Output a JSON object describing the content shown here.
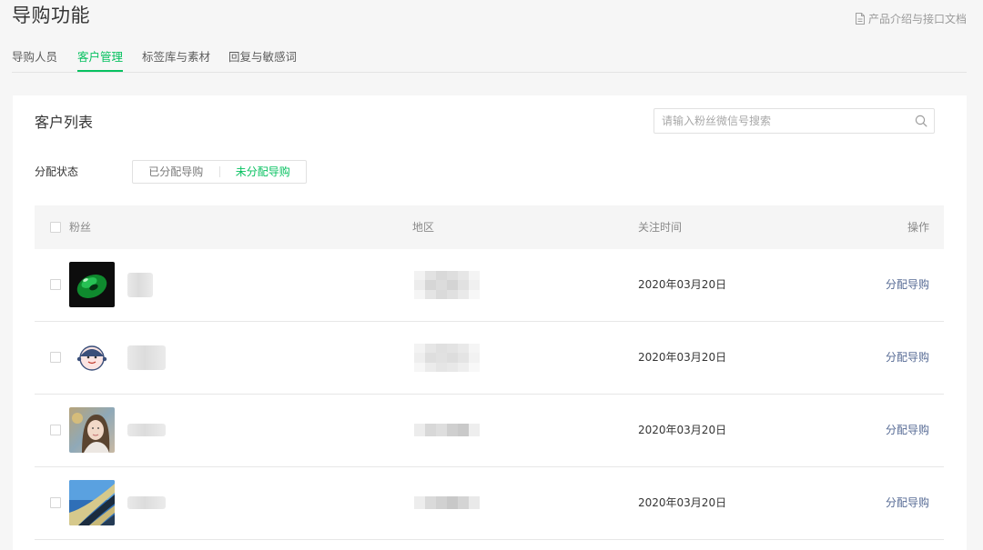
{
  "header": {
    "title": "导购功能",
    "doc_link_label": "产品介绍与接口文档",
    "doc_icon": "document-icon"
  },
  "tabs": [
    {
      "label": "导购人员",
      "active": false
    },
    {
      "label": "客户管理",
      "active": true
    },
    {
      "label": "标签库与素材",
      "active": false
    },
    {
      "label": "回复与敏感词",
      "active": false
    }
  ],
  "customer_list": {
    "title": "客户列表",
    "search": {
      "placeholder": "请输入粉丝微信号搜索",
      "value": "",
      "icon": "search-icon"
    },
    "filter": {
      "label": "分配状态",
      "options": [
        {
          "label": "已分配导购",
          "active": false
        },
        {
          "label": "未分配导购",
          "active": true
        }
      ]
    },
    "table": {
      "columns": {
        "fan": "粉丝",
        "region": "地区",
        "follow_time": "关注时间",
        "action": "操作"
      },
      "rows": [
        {
          "avatar": "jade-pendant-avatar",
          "follow_time": "2020年03月20日",
          "action": "分配导购"
        },
        {
          "avatar": "cartoon-face-avatar",
          "follow_time": "2020年03月20日",
          "action": "分配导购"
        },
        {
          "avatar": "portrait-photo-avatar",
          "follow_time": "2020年03月20日",
          "action": "分配导购"
        },
        {
          "avatar": "architecture-photo-avatar",
          "follow_time": "2020年03月20日",
          "action": "分配导购"
        }
      ]
    }
  },
  "colors": {
    "accent": "#07c160",
    "link": "#576b95",
    "page_background": "#f6f6f6",
    "card_background": "#ffffff"
  }
}
